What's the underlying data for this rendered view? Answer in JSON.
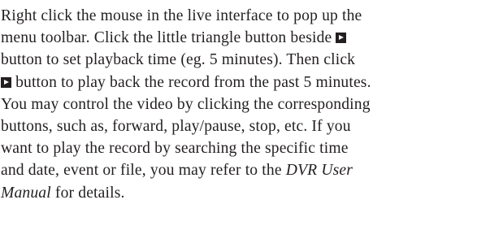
{
  "paragraph": {
    "line1": "Right click the mouse in the live interface to pop up the",
    "line2": "menu toolbar. Click the little triangle button beside",
    "line3": "button to set playback time (eg. 5 minutes). Then click",
    "line4": "button to play back the record from the past 5 minutes.",
    "line5": "You may control the video by clicking the corresponding",
    "line6": "buttons, such as, forward, play/pause, stop, etc. If you",
    "line7": "want to play the record by searching the specific time",
    "line8_start": "and date, event or file, you may refer to the",
    "line8_italic": "DVR User",
    "line9_italic": "Manual",
    "line9_end": "for details."
  },
  "icons": {
    "playback_button": "play-icon"
  }
}
